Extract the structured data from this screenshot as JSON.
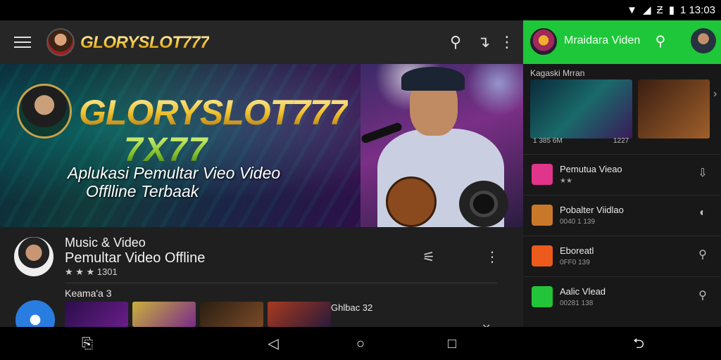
{
  "status_bar": {
    "clock": "1 13:03",
    "icons": [
      "wifi-icon",
      "signal-icon",
      "sim-icon",
      "battery-icon"
    ]
  },
  "app_bar": {
    "logo_text": "GLORYSLOT777",
    "icons": [
      "menu-icon",
      "search-icon",
      "share-icon",
      "more-vert-icon"
    ]
  },
  "banner": {
    "title": "GLORYSLOT777",
    "subtitle": "7X77",
    "tagline_line1": "Aplukasi Pemultar Vieo Video",
    "tagline_line2": "Offlline Terbaak"
  },
  "app_info": {
    "category": "Music & Video",
    "name": "Pemultar Video Offline",
    "rating": "★ ★ ★ 1301"
  },
  "section": {
    "title": "Keama'a 3",
    "thumb_caption": "Ghlbac 32",
    "thumb_colors": [
      "#3a1a5a",
      "#b8a030",
      "#3a2a18",
      "#8a2a1a"
    ]
  },
  "side_panel": {
    "header_title": "Mraidara Viden",
    "section_title": "Kagaski Mrran",
    "thumb_meta_left": "1 385 6M",
    "thumb_meta_right": "1227",
    "items": [
      {
        "title": "Pemutua Vieao",
        "sub": "★★",
        "tile_color": "#e0358a",
        "icon": "play-icon",
        "action_icon": "download-icon"
      },
      {
        "title": "Pobalter Viidlao",
        "sub": "0040 1 139",
        "tile_color": "#c9782a",
        "icon": "wave-icon",
        "action_icon": "toggle-icon"
      },
      {
        "title": "Eboreatl",
        "sub": "0FF0 139",
        "tile_color": "#ec5a1c",
        "icon": "play-icon",
        "action_icon": "search-icon"
      },
      {
        "title": "Aalic Vlead",
        "sub": "00281 138",
        "tile_color": "#22c43a",
        "icon": "chat-icon",
        "action_icon": "search-icon"
      }
    ]
  },
  "nav_bar": {
    "icons": [
      "recents-alt-icon",
      "back-icon",
      "home-icon",
      "overview-icon",
      "rotate-icon"
    ]
  }
}
